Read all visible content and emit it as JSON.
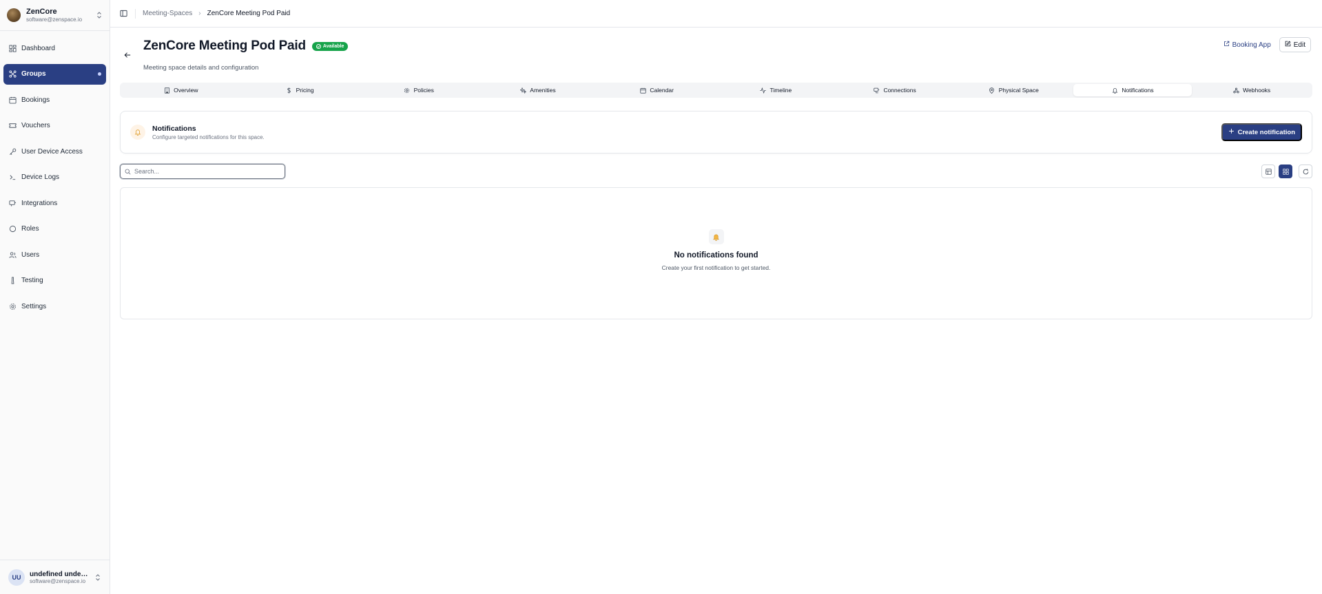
{
  "org": {
    "name": "ZenCore",
    "email": "software@zenspace.io"
  },
  "nav": [
    {
      "label": "Dashboard",
      "icon": "dashboard-icon",
      "active": false
    },
    {
      "label": "Groups",
      "icon": "groups-icon",
      "active": true
    },
    {
      "label": "Bookings",
      "icon": "calendar-icon",
      "active": false
    },
    {
      "label": "Vouchers",
      "icon": "ticket-icon",
      "active": false
    },
    {
      "label": "User Device Access",
      "icon": "key-icon",
      "active": false
    },
    {
      "label": "Device Logs",
      "icon": "terminal-icon",
      "active": false
    },
    {
      "label": "Integrations",
      "icon": "plug-icon",
      "active": false
    },
    {
      "label": "Roles",
      "icon": "shield-icon",
      "active": false
    },
    {
      "label": "Users",
      "icon": "users-icon",
      "active": false
    },
    {
      "label": "Testing",
      "icon": "flask-icon",
      "active": false
    },
    {
      "label": "Settings",
      "icon": "gear-icon",
      "active": false
    }
  ],
  "user": {
    "initials": "UU",
    "name": "undefined undefin...",
    "email": "software@zenspace.io"
  },
  "breadcrumb": {
    "parent": "Meeting-Spaces",
    "current": "ZenCore Meeting Pod Paid"
  },
  "header": {
    "title": "ZenCore Meeting Pod Paid",
    "badge": "Available",
    "subtitle": "Meeting space details and configuration",
    "booking_app": "Booking App",
    "edit": "Edit"
  },
  "tabs": [
    {
      "label": "Overview",
      "icon": "building-icon",
      "active": false
    },
    {
      "label": "Pricing",
      "icon": "dollar-icon",
      "active": false
    },
    {
      "label": "Policies",
      "icon": "gear-icon",
      "active": false
    },
    {
      "label": "Amenities",
      "icon": "sparkle-icon",
      "active": false
    },
    {
      "label": "Calendar",
      "icon": "calendar-icon",
      "active": false
    },
    {
      "label": "Timeline",
      "icon": "activity-icon",
      "active": false
    },
    {
      "label": "Connections",
      "icon": "cable-icon",
      "active": false
    },
    {
      "label": "Physical Space",
      "icon": "map-pin-icon",
      "active": false
    },
    {
      "label": "Notifications",
      "icon": "bell-icon",
      "active": true
    },
    {
      "label": "Webhooks",
      "icon": "webhook-icon",
      "active": false
    }
  ],
  "section": {
    "title": "Notifications",
    "description": "Configure targeted notifications for this space.",
    "create_label": "Create notification"
  },
  "search": {
    "placeholder": "Search...",
    "value": ""
  },
  "empty": {
    "title": "No notifications found",
    "description": "Create your first notification to get started."
  },
  "colors": {
    "primary": "#2a3f83",
    "success": "#16a34a",
    "warning": "#e0a030"
  }
}
